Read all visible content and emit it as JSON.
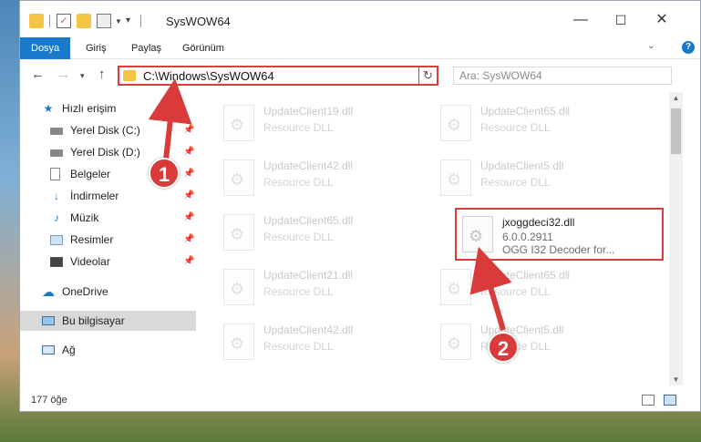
{
  "window": {
    "title": "SysWOW64",
    "controls": {
      "minimize": "—",
      "maximize": "☐",
      "close": "✕"
    }
  },
  "ribbon": {
    "tabs": [
      "Dosya",
      "Giriş",
      "Paylaş",
      "Görünüm"
    ],
    "active_tab": "Dosya"
  },
  "nav": {
    "address": "C:\\Windows\\SysWOW64",
    "search_placeholder": "Ara: SysWOW64"
  },
  "sidebar": {
    "items": [
      {
        "label": "Hızlı erişim",
        "icon": "star-icon",
        "pinned": false
      },
      {
        "label": "Yerel Disk (C:)",
        "icon": "drive-icon",
        "pinned": true
      },
      {
        "label": "Yerel Disk (D:)",
        "icon": "drive-icon",
        "pinned": true
      },
      {
        "label": "Belgeler",
        "icon": "documents-icon",
        "pinned": true
      },
      {
        "label": "İndirmeler",
        "icon": "download-icon",
        "pinned": true
      },
      {
        "label": "Müzik",
        "icon": "music-icon",
        "pinned": true
      },
      {
        "label": "Resimler",
        "icon": "pictures-icon",
        "pinned": true
      },
      {
        "label": "Videolar",
        "icon": "video-icon",
        "pinned": true
      },
      {
        "label": "OneDrive",
        "icon": "cloud-icon",
        "pinned": false
      },
      {
        "label": "Bu bilgisayar",
        "icon": "computer-icon",
        "pinned": false,
        "selected": true
      },
      {
        "label": "Ağ",
        "icon": "network-icon",
        "pinned": false
      }
    ]
  },
  "files": [
    {
      "name": "UpdateClient19.dll",
      "sub1": "Resource DLL",
      "faded": true
    },
    {
      "name": "UpdateClient65.dll",
      "sub1": "Resource DLL",
      "faded": true
    },
    {
      "name": "UpdateClient42.dll",
      "sub1": "Resource DLL",
      "faded": true
    },
    {
      "name": "UpdateClient5.dll",
      "sub1": "Resource DLL",
      "faded": true
    },
    {
      "name": "UpdateClient65.dll",
      "sub1": "Resource DLL",
      "faded": true
    },
    {
      "name": "jxoggdeci32.dll",
      "sub1": "6.0.0.2911",
      "sub2": "OGG I32 Decoder for...",
      "faded": false
    },
    {
      "name": "UpdateClient21.dll",
      "sub1": "Resource DLL",
      "faded": true
    },
    {
      "name": "UpdateClient65.dll",
      "sub1": "Resource DLL",
      "faded": true
    },
    {
      "name": "UpdateClient42.dll",
      "sub1": "Resource DLL",
      "faded": true
    },
    {
      "name": "UpdateClient5.dll",
      "sub1": "Resource DLL",
      "faded": true
    }
  ],
  "status": {
    "count": "177 öğe"
  },
  "callouts": [
    "1",
    "2"
  ],
  "colors": {
    "accent": "#1979ca",
    "highlight": "#e23b3b"
  }
}
